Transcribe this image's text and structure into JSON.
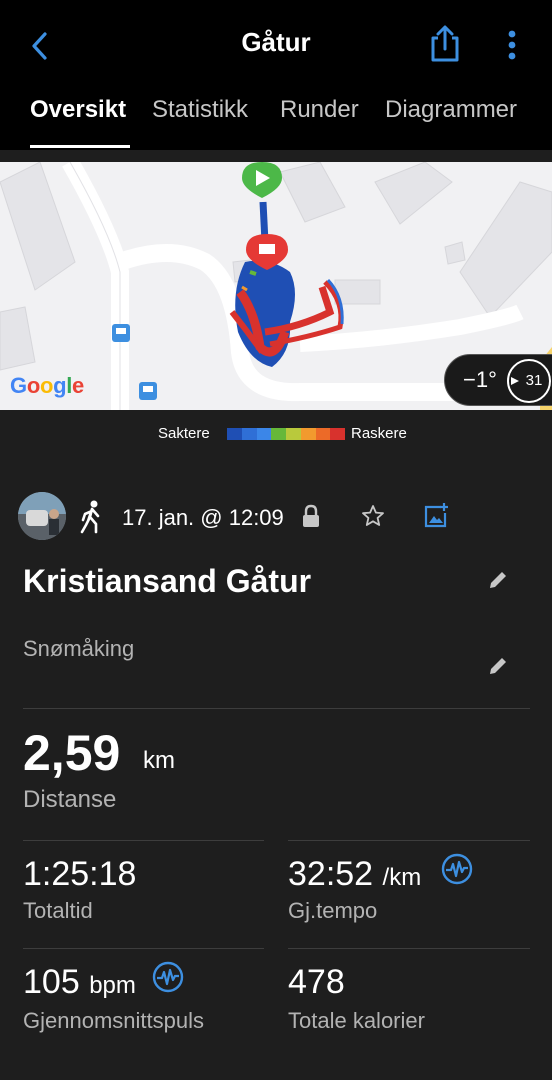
{
  "header": {
    "title": "Gåtur",
    "back_icon": "chevron-left-icon",
    "share_icon": "share-icon",
    "more_icon": "more-vertical-icon",
    "accent": "#3d8fe0"
  },
  "tabs": [
    {
      "label": "Oversikt",
      "active": true
    },
    {
      "label": "Statistikk",
      "active": false
    },
    {
      "label": "Runder",
      "active": false
    },
    {
      "label": "Diagrammer",
      "active": false
    }
  ],
  "map": {
    "logo_text": "Google",
    "temperature": "−1°",
    "wind": "31"
  },
  "legend": {
    "slow_label": "Saktere",
    "fast_label": "Raskere",
    "colors": [
      "#1f4fb4",
      "#2f6fd6",
      "#3b86e8",
      "#66b83a",
      "#b9c93c",
      "#f29a2e",
      "#ec6a28",
      "#d8322d"
    ]
  },
  "activity": {
    "date": "17. jan. @ 12:09",
    "name": "Kristiansand Gåtur",
    "notes": "Snømåking"
  },
  "stats": {
    "distance": {
      "value": "2,59",
      "unit": "km",
      "label": "Distanse"
    },
    "total_time": {
      "value": "1:25:18",
      "label": "Totaltid"
    },
    "avg_pace": {
      "value": "32:52",
      "unit": "/km",
      "label": "Gj.tempo"
    },
    "avg_hr": {
      "value": "105",
      "unit": "bpm",
      "label": "Gjennomsnittspuls"
    },
    "calories": {
      "value": "478",
      "label": "Totale kalorier"
    }
  }
}
